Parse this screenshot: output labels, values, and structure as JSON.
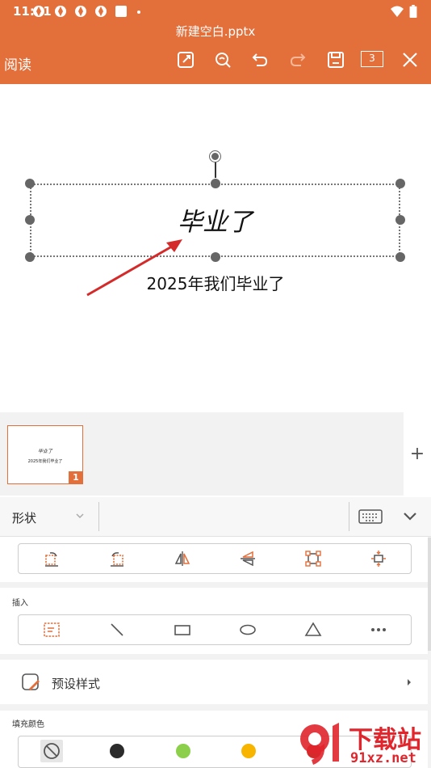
{
  "status": {
    "time": "11:01"
  },
  "header": {
    "title": "新建空白.pptx",
    "mode_label": "阅读",
    "page_count": "3"
  },
  "slide": {
    "title_text": "毕业了",
    "subtitle_text": "2025年我们毕业了"
  },
  "thumbnails": [
    {
      "title": "毕业了",
      "subtitle": "2025年我们毕业了",
      "number": "1"
    }
  ],
  "add_slide_label": "+",
  "panel": {
    "dropdown_value": "形状",
    "insert_label": "插入",
    "preset_label": "预设样式",
    "fill_label": "填充颜色",
    "fill_colors": [
      "none",
      "#2b2b2b",
      "#8ccf4a",
      "#f7b500",
      "#d42a2a"
    ]
  },
  "watermark": {
    "text": "下载站",
    "domain": "91xz.net"
  },
  "colors": {
    "accent": "#e36f3a",
    "icon_orange": "#e36f3a"
  }
}
